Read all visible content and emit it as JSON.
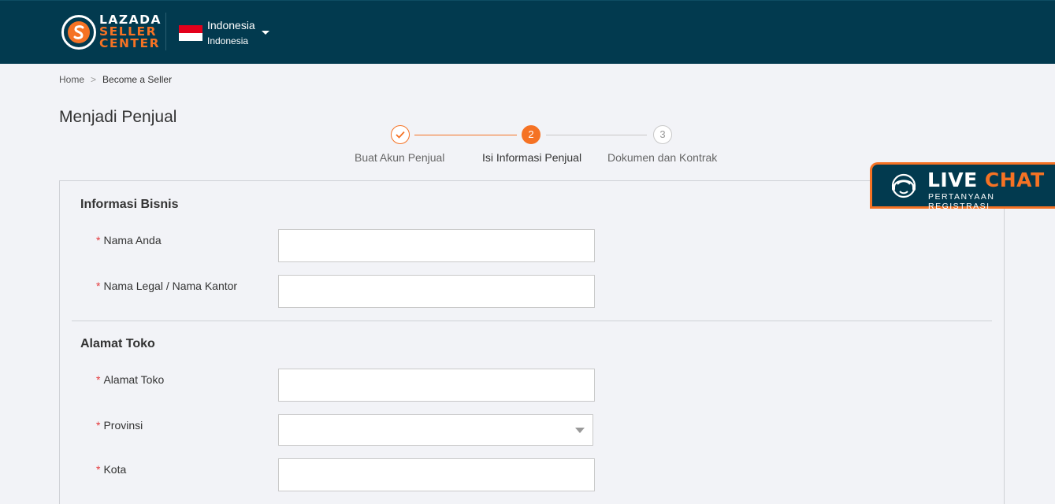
{
  "header": {
    "brand_line1": "LAZADA",
    "brand_line2": "SELLER",
    "brand_line3": "CENTER",
    "country_main": "Indonesia",
    "country_sub": "Indonesia"
  },
  "breadcrumb": {
    "home": "Home",
    "separator": ">",
    "current": "Become a Seller"
  },
  "page_title": "Menjadi Penjual",
  "steps": [
    {
      "number": "✓",
      "label": "Buat Akun Penjual",
      "status": "done"
    },
    {
      "number": "2",
      "label": "Isi Informasi Penjual",
      "status": "active"
    },
    {
      "number": "3",
      "label": "Dokumen dan Kontrak",
      "status": "pending"
    }
  ],
  "form": {
    "business_section": "Informasi Bisnis",
    "name_label": "Nama Anda",
    "name_value": "",
    "legal_label": "Nama Legal / Nama Kantor",
    "legal_value": "",
    "address_section": "Alamat Toko",
    "address_label": "Alamat Toko",
    "address_value": "",
    "province_label": "Provinsi",
    "province_value": "",
    "city_label": "Kota",
    "city_value": "",
    "required_mark": "*"
  },
  "livechat": {
    "live": "LIVE",
    "chat": "CHAT",
    "subtitle": "PERTANYAAN REGISTRASI"
  },
  "colors": {
    "header_bg": "#023a4f",
    "accent": "#f57224",
    "page_bg": "#f2f3f7",
    "required": "#e4393c"
  },
  "icons": [
    "seller-center-logo-icon",
    "indonesia-flag-icon",
    "dropdown-caret-icon",
    "checkmark-icon",
    "chevron-down-icon",
    "headset-agent-icon"
  ]
}
